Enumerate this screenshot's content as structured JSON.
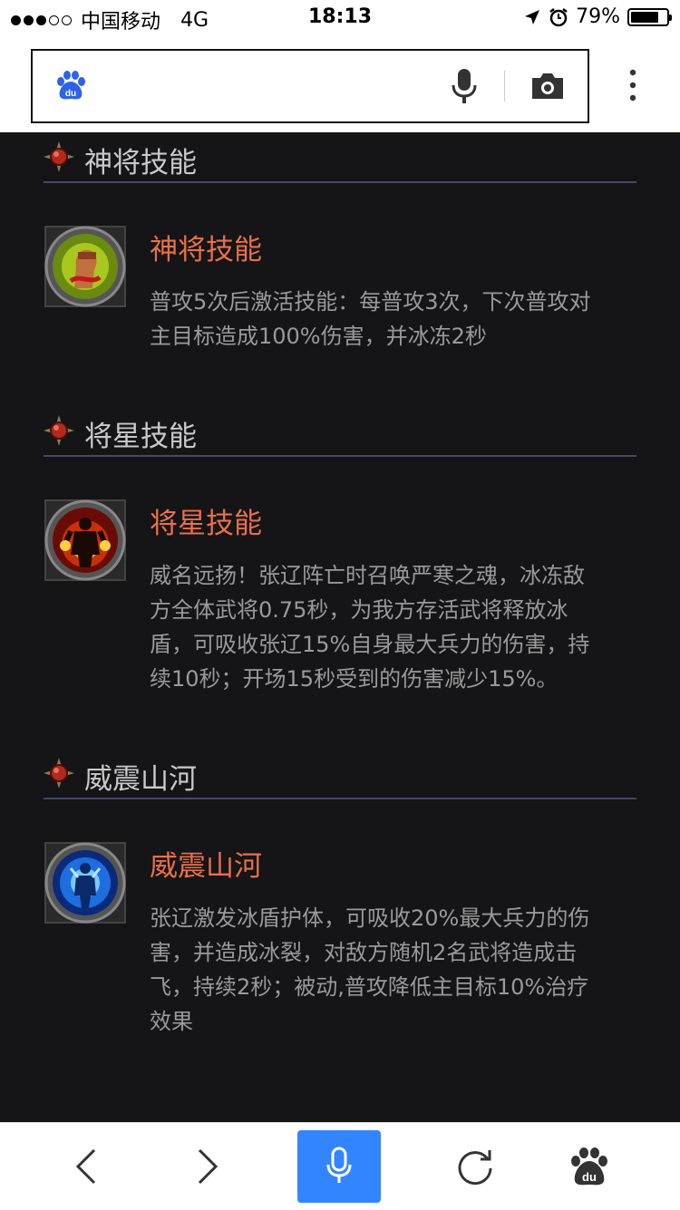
{
  "status_bar": {
    "signal_dots_filled": 3,
    "signal_dots_total": 5,
    "carrier": "中国移动",
    "network": "4G",
    "time": "18:13",
    "battery_percent": "79%",
    "battery_level": 0.79
  },
  "search_bar": {
    "logo_text": "du",
    "icons": [
      "baidu-logo",
      "microphone",
      "camera",
      "more-vertical"
    ]
  },
  "sections": [
    {
      "header": "神将技能",
      "skill_name": "神将技能",
      "description": [
        "普攻5次后激活技能：每普攻3次，下次普攻对",
        "主目标造成100%伤害，并冰冻2秒"
      ]
    },
    {
      "header": "将星技能",
      "skill_name": "将星技能",
      "description": [
        "威名远扬！张辽阵亡时召唤严寒之魂，冰冻敌",
        "方全体武将0.75秒，为我方存活武将释放冰",
        "盾，可吸收张辽15%自身最大兵力的伤害，持",
        "续10秒；开场15秒受到的伤害减少15%。"
      ]
    },
    {
      "header": "威震山河",
      "skill_name": "威震山河",
      "description": [
        "张辽激发冰盾护体，可吸收20%最大兵力的伤",
        "害，并造成冰裂，对敌方随机2名武将造成击",
        "飞，持续2秒；被动,普攻降低主目标10%治疗",
        "效果"
      ]
    }
  ],
  "bottom_bar": {
    "logo_text": "du",
    "items": [
      "back",
      "forward",
      "voice",
      "refresh",
      "baidu-home"
    ]
  },
  "colors": {
    "content_bg": "#151416",
    "skill_name": "#e8714a",
    "section_title": "#c9c9c9",
    "description": "#9a9a9a",
    "divider": "#4a4766",
    "voice_button": "#3385ff"
  }
}
